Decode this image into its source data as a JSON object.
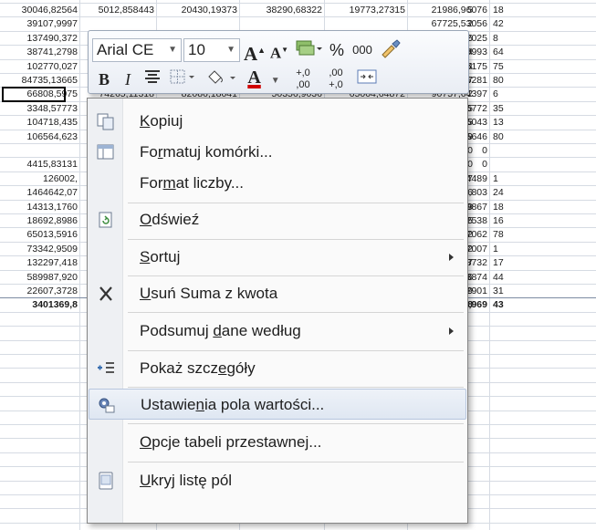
{
  "sheet": {
    "rows": [
      [
        "30046,82564",
        "5012,858443",
        "20430,19373",
        "38290,68322",
        "19773,27315",
        "21986,96076",
        "18"
      ],
      [
        "39107,9997",
        "",
        "",
        "",
        "",
        "67725,53056",
        "42"
      ],
      [
        "137490,372",
        "",
        "",
        "",
        "",
        "107443,2025",
        "8"
      ],
      [
        "38741,2798",
        "",
        "",
        "",
        "",
        "84489,9993",
        "64"
      ],
      [
        "102770,027",
        "",
        "",
        "",
        "",
        "112585,5175",
        "75"
      ],
      [
        "84735,13665",
        "",
        "",
        "",
        "",
        "84713,86281",
        "80"
      ],
      [
        "66808,5975",
        "74265,11318",
        "82086,18041",
        "50356,9036",
        "65004,64872",
        "90757,64397",
        "6"
      ],
      [
        "3348,57773",
        "",
        "",
        "",
        "",
        "3739,386772",
        "35"
      ],
      [
        "104718,435",
        "",
        "",
        "",
        "",
        "138383,5043",
        "13"
      ],
      [
        "106564,623",
        "",
        "",
        "",
        "",
        "98730,95646",
        "80"
      ],
      [
        "",
        "",
        "",
        "",
        "",
        "0",
        ""
      ],
      [
        "4415,83131",
        "",
        "",
        "",
        "",
        "0",
        ""
      ],
      [
        "126002,",
        "",
        "",
        "",
        "",
        "332931,4489",
        "1"
      ],
      [
        "1464642,07",
        "",
        "",
        "",
        "",
        "1925558,803",
        "24"
      ],
      [
        "14313,1760",
        "",
        "",
        "",
        "",
        "16443,39867",
        "18"
      ],
      [
        "18692,8986",
        "",
        "",
        "",
        "",
        "19569,62538",
        "16"
      ],
      [
        "65013,5916",
        "",
        "",
        "",
        "",
        "112176,7062",
        "78"
      ],
      [
        "73342,9509",
        "",
        "",
        "",
        "",
        "79600,47007",
        "1"
      ],
      [
        "132297,418",
        "",
        "",
        "",
        "",
        "145135,8732",
        "17"
      ],
      [
        "589987,920",
        "",
        "",
        "",
        "",
        "721724,3874",
        "44"
      ],
      [
        "22607,3728",
        "",
        "",
        "",
        "",
        "17070,62901",
        "31"
      ],
      [
        "3401369,8",
        "",
        "",
        "",
        "",
        "4354120,969",
        "43"
      ]
    ],
    "peek_digits": [
      "5",
      "2",
      "6",
      "4",
      "4",
      "7",
      "2",
      "5",
      "5",
      "9",
      "0",
      "0",
      "7",
      "6",
      "9",
      "5",
      "2",
      "2",
      "7",
      "6",
      "9",
      "8"
    ]
  },
  "toolbar": {
    "font_name": "Arial CE",
    "font_size": "10",
    "grow_font": "A",
    "shrink_font": "A",
    "percent": "%",
    "thousands": "000",
    "bold": "B",
    "italic": "I",
    "font_color_letter": "A",
    "increase_decimal": "+,0",
    "increase_decimal_2": ",00",
    "decrease_decimal": ",00",
    "decrease_decimal_2": "+,0"
  },
  "menu": {
    "kopiuj": {
      "pre": "",
      "ul": "K",
      "post": "opiuj"
    },
    "formatuj": {
      "pre": "Fo",
      "ul": "r",
      "post": "matuj komórki..."
    },
    "format_liczby": {
      "pre": "For",
      "ul": "m",
      "post": "at liczby..."
    },
    "odswiez": {
      "pre": "",
      "ul": "O",
      "post": "dświeź"
    },
    "sortuj": {
      "pre": "",
      "ul": "S",
      "post": "ortuj"
    },
    "usun": {
      "pre": "",
      "ul": "U",
      "post": "suń Suma z kwota"
    },
    "podsumuj": {
      "pre": "Podsumuj ",
      "ul": "d",
      "post": "ane według"
    },
    "pokaz": {
      "pre": "Pokaż szcz",
      "ul": "e",
      "post": "góły"
    },
    "ustawienia": {
      "pre": "Ustawie",
      "ul": "n",
      "post": "ia pola wartości..."
    },
    "opcje": {
      "pre": "",
      "ul": "O",
      "post": "pcje tabeli przestawnej..."
    },
    "ukryj": {
      "pre": "",
      "ul": "U",
      "post": "kryj listę pól"
    }
  }
}
